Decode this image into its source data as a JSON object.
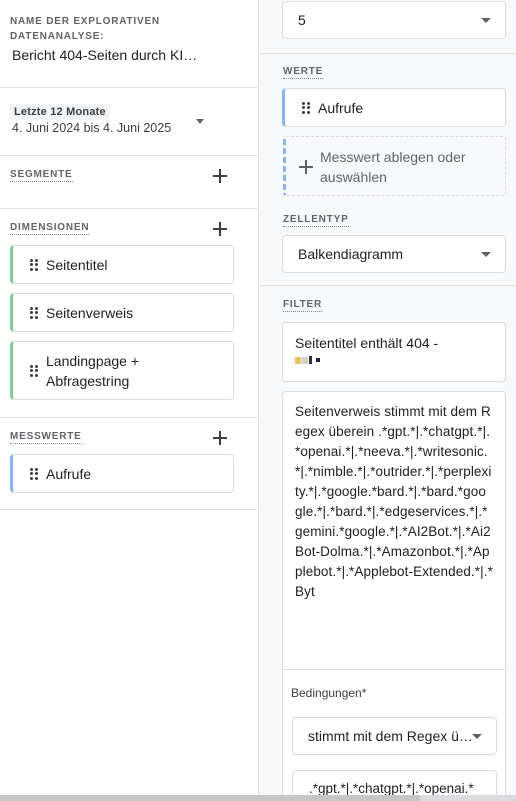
{
  "left": {
    "name_label": "NAME DER EXPLORATIVEN DATENANALYSE:",
    "name_value": "Bericht 404-Seiten durch KI…",
    "date_chip": "Letzte 12 Monate",
    "date_range": "4. Juni 2024 bis 4. Juni 2025",
    "segments_label": "SEGMENTE",
    "dimensions_label": "DIMENSIONEN",
    "dimensions": [
      {
        "label": "Seitentitel"
      },
      {
        "label": "Seitenverweis"
      },
      {
        "label": "Landingpage +\nAbfragestring"
      }
    ],
    "metrics_label": "MESSWERTE",
    "metrics": [
      {
        "label": "Aufrufe"
      }
    ]
  },
  "right": {
    "rows_select_value": "5",
    "values_label": "WERTE",
    "values_chip": "Aufrufe",
    "drop_text": "Messwert ablegen oder auswählen",
    "cell_type_label": "ZELLENTYP",
    "cell_type_value": "Balkendiagramm",
    "filter_label": "FILTER",
    "filter_1": "Seitentitel enthält 404 -",
    "filter_2": "Seitenverweis stimmt mit dem Regex überein .*gpt.*|.*chatgpt.*|.*openai.*|.*neeva.*|.*writesonic.*|.*nimble.*|.*outrider.*|.*perplexity.*|.*google.*bard.*|.*bard.*google.*|.*bard.*|.*edgeservices.*|.*gemini.*google.*|.*AI2Bot.*|.*Ai2Bot-Dolma.*|.*Amazonbot.*|.*Applebot.*|.*Applebot-Extended.*|.*Byt",
    "conditions_label": "Bedingungen*",
    "conditions_select": "stimmt mit dem Regex ü…",
    "conditions_value": ".*gpt.*|.*chatgpt.*|.*openai.*"
  },
  "colors": {
    "dimension_accent": "#81c995",
    "metric_accent": "#8ab4f8",
    "border": "#dadce0"
  }
}
